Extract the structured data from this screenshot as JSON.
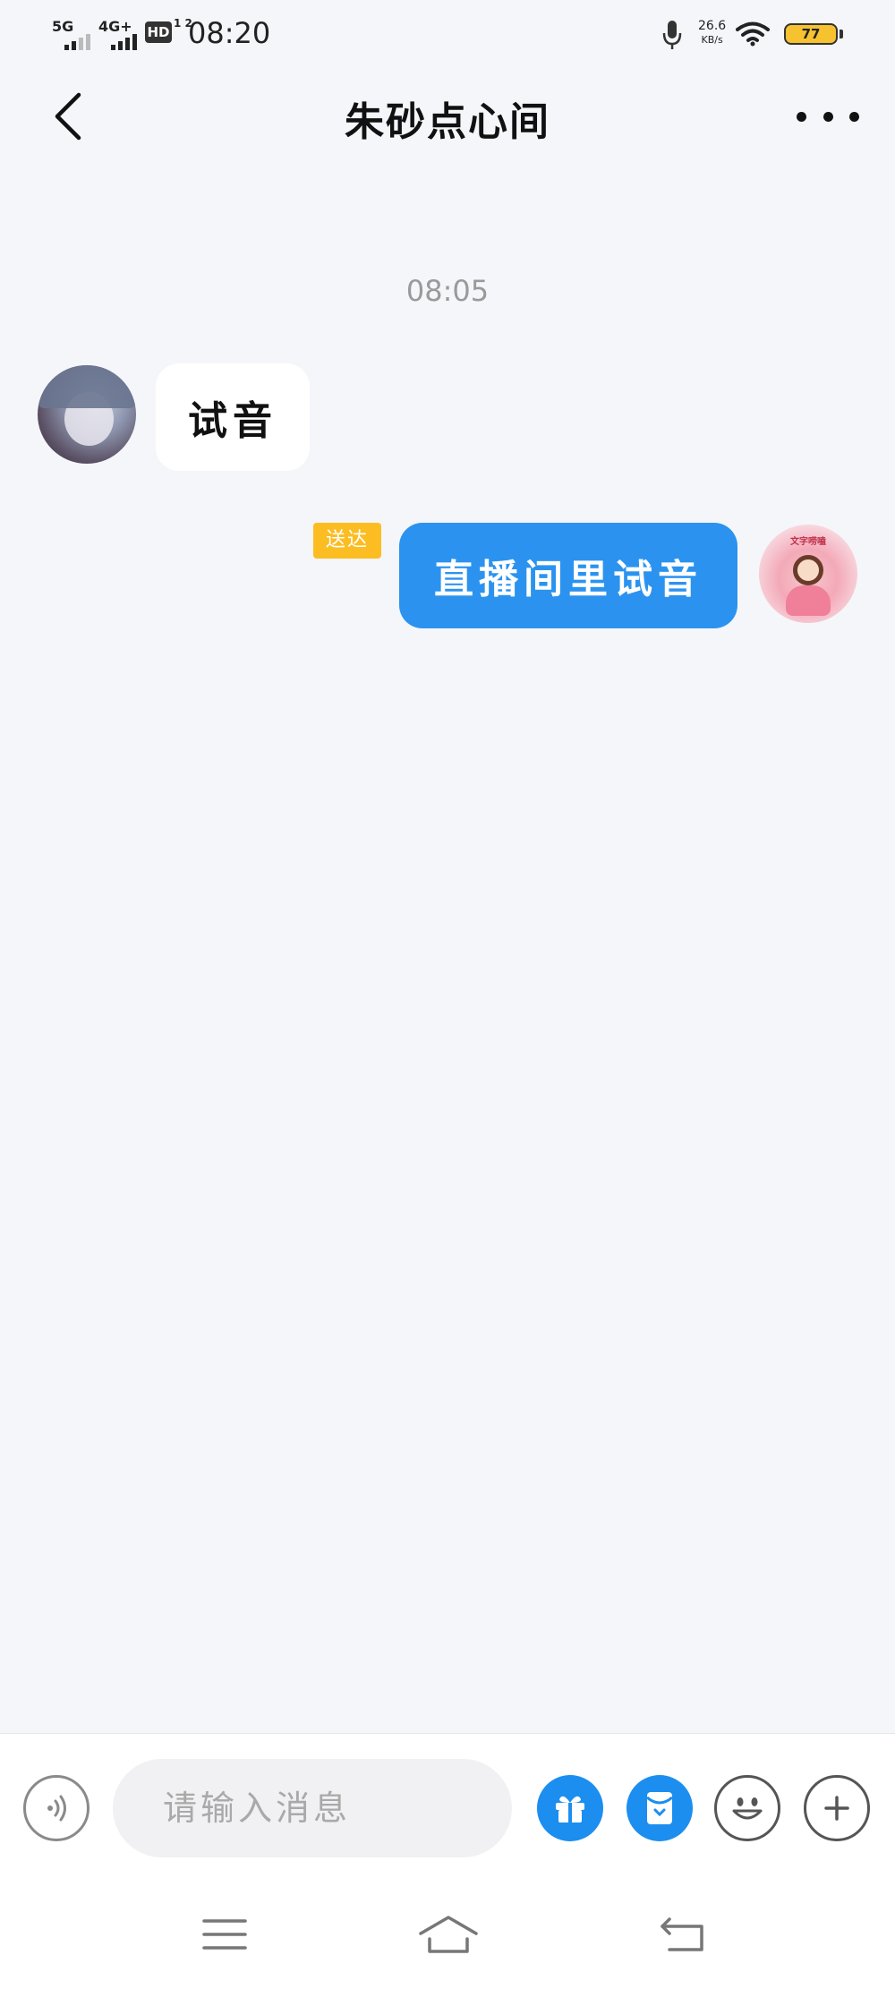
{
  "status_bar": {
    "time": "08:20",
    "sim1_type": "5G",
    "sim2_type": "4G+",
    "hd_label": "HD",
    "hd_sub": "1 2",
    "net_speed_value": "26.6",
    "net_speed_unit": "KB/s",
    "battery_level": "77",
    "icons": [
      "signal-icon",
      "microphone-icon",
      "wifi-icon",
      "battery-icon"
    ]
  },
  "header": {
    "title": "朱砂点心间",
    "back_icon": "chevron-left-icon",
    "more_icon": "more-dots-icon"
  },
  "chat": {
    "timestamp": "08:05",
    "messages": [
      {
        "side": "left",
        "text": "试音"
      },
      {
        "side": "right",
        "text": "直播间里试音",
        "status": "送达"
      }
    ],
    "right_avatar_caption": "文字唠嗑"
  },
  "input_bar": {
    "placeholder": "请输入消息",
    "buttons": [
      "voice-icon",
      "gift-icon",
      "red-packet-icon",
      "emoji-icon",
      "plus-icon"
    ]
  },
  "nav_bar": {
    "buttons": [
      "menu-icon",
      "home-icon",
      "back-icon"
    ]
  },
  "colors": {
    "accent_blue": "#2b93ef",
    "badge_yellow": "#fbbd22",
    "background": "#f4f6fa"
  }
}
